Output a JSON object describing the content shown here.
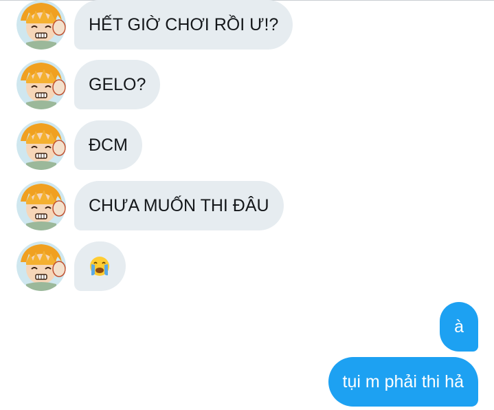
{
  "messages": [
    {
      "side": "in",
      "text": "HẾT GIỜ CHƠI RỒI Ư!?"
    },
    {
      "side": "in",
      "text": "GELO?"
    },
    {
      "side": "in",
      "text": "ĐCM"
    },
    {
      "side": "in",
      "text": "CHƯA MUỐN THI ĐÂU"
    },
    {
      "side": "in",
      "text": "😭"
    },
    {
      "side": "out",
      "text": "à"
    },
    {
      "side": "out",
      "text": "tụi m phải thi hả"
    }
  ],
  "colors": {
    "incoming_bubble": "#e6ecf0",
    "outgoing_bubble": "#1da1f2",
    "incoming_text": "#14171a",
    "outgoing_text": "#ffffff"
  },
  "icons": {
    "sender_avatar": "avatar-anime-boy-icon",
    "crying_emoji": "loudly-crying-face-emoji"
  }
}
